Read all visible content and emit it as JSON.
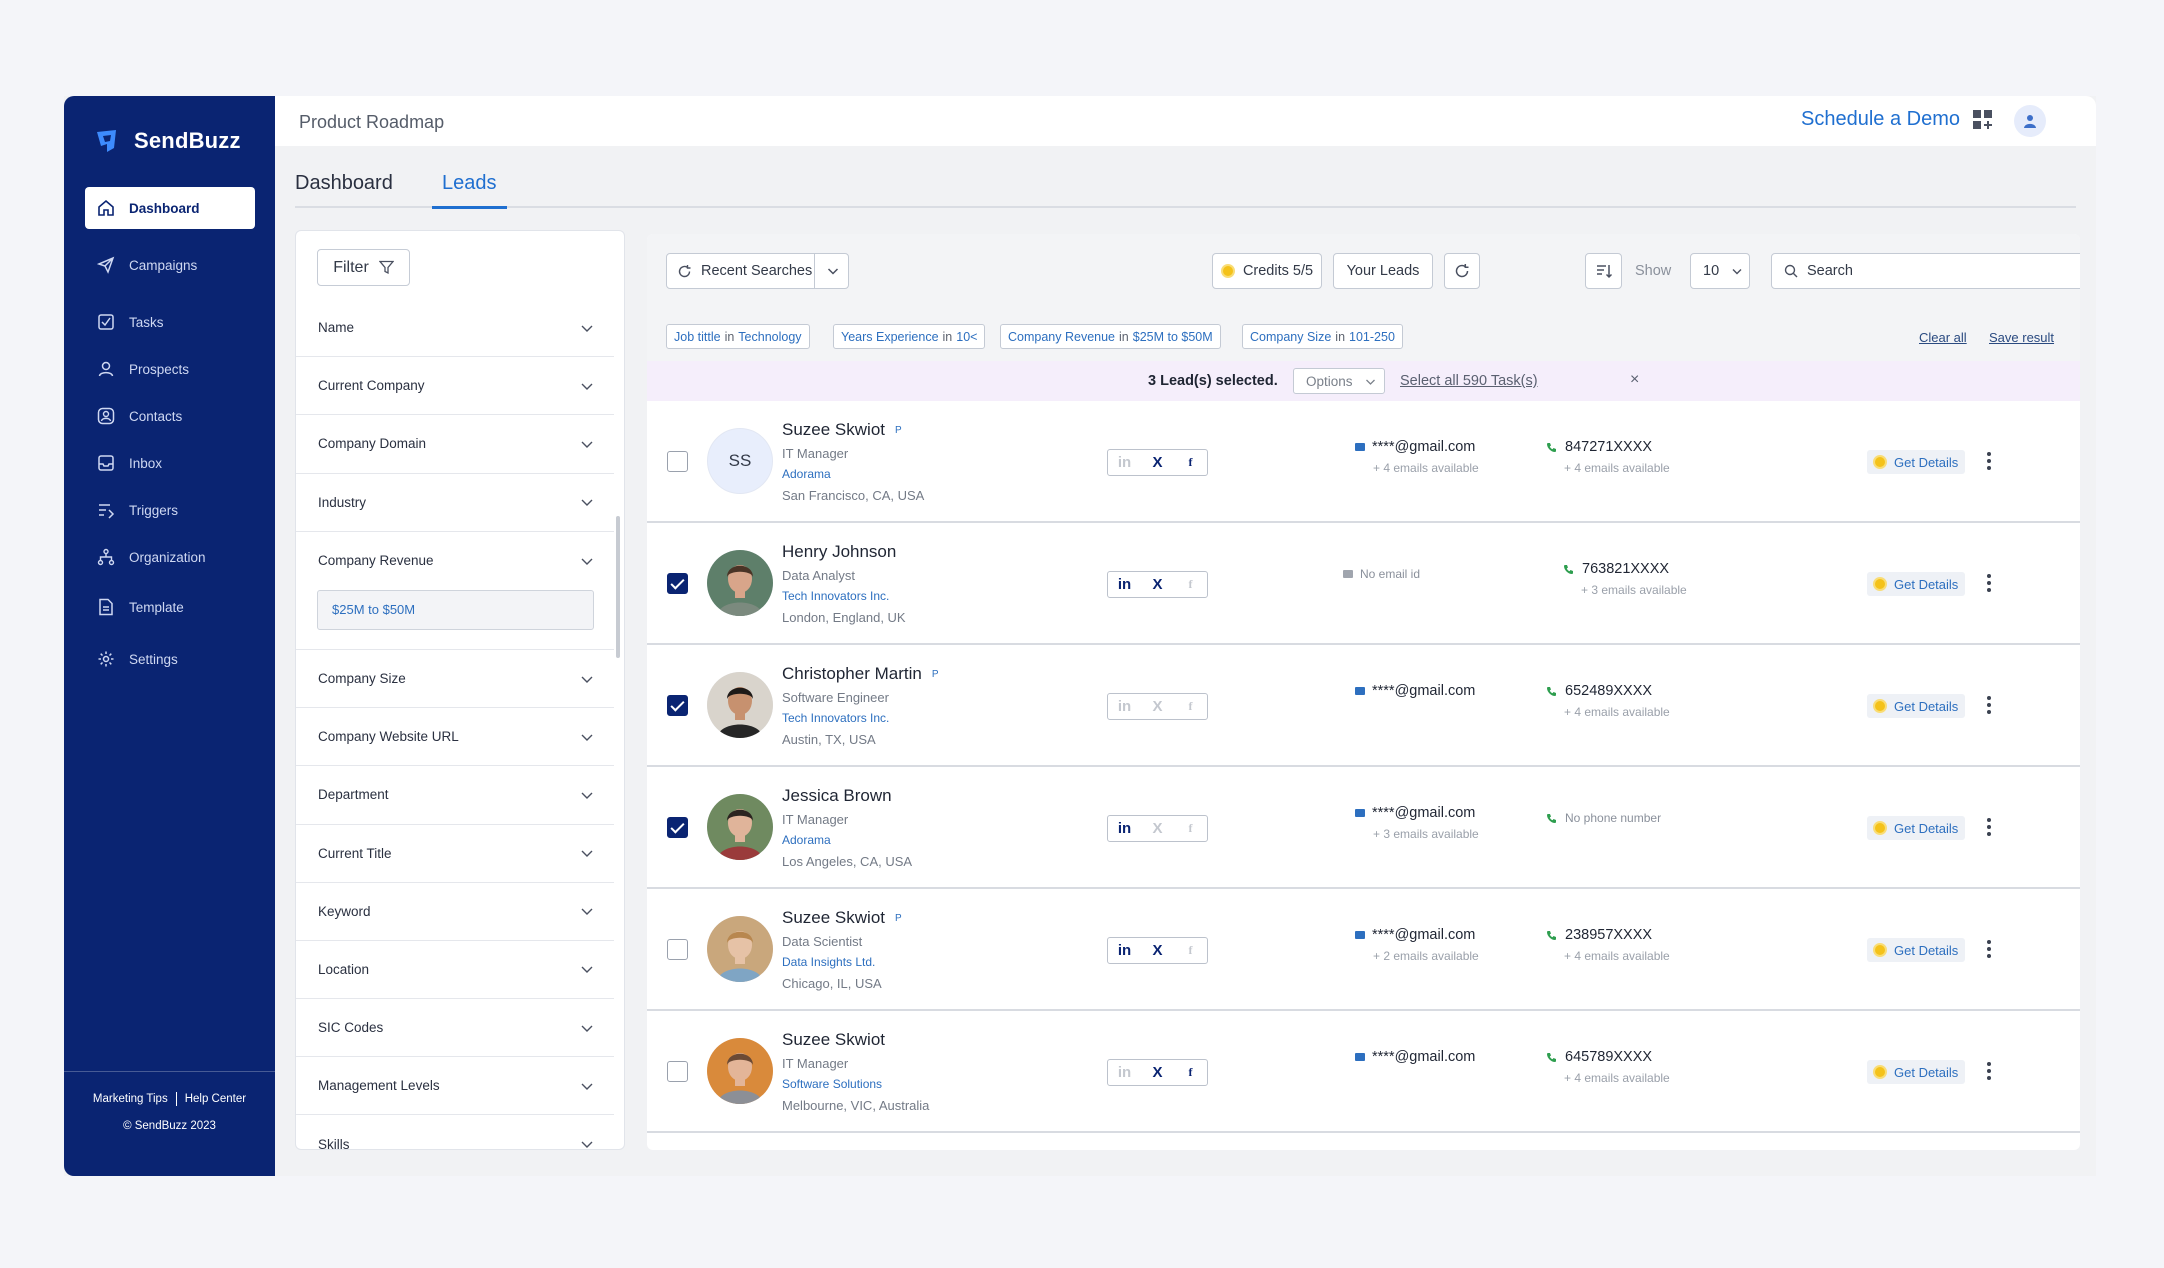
{
  "app": {
    "name": "SendBuzz"
  },
  "sidebar": {
    "items": [
      {
        "label": "Dashboard",
        "icon": "home-icon",
        "active": true
      },
      {
        "label": "Campaigns",
        "icon": "send-icon"
      },
      {
        "label": "Tasks",
        "icon": "task-icon"
      },
      {
        "label": "Prospects",
        "icon": "user-icon"
      },
      {
        "label": "Contacts",
        "icon": "contacts-icon"
      },
      {
        "label": "Inbox",
        "icon": "inbox-icon"
      },
      {
        "label": "Triggers",
        "icon": "triggers-icon"
      },
      {
        "label": "Organization",
        "icon": "organization-icon"
      },
      {
        "label": "Template",
        "icon": "template-icon"
      },
      {
        "label": "Settings",
        "icon": "gear-icon"
      }
    ],
    "footer": {
      "link1": "Marketing Tips",
      "link2": "Help Center",
      "copyright": "© SendBuzz 2023"
    }
  },
  "topbar": {
    "breadcrumb": "Product Roadmap",
    "demo_link": "Schedule a Demo"
  },
  "tabs": [
    {
      "label": "Dashboard"
    },
    {
      "label": "Leads",
      "active": true
    }
  ],
  "filters": {
    "button_label": "Filter",
    "items": [
      "Name",
      "Current Company",
      "Company Domain",
      "Industry",
      "Company Revenue",
      "Company Size",
      "Company Website URL",
      "Department",
      "Current Title",
      "Keyword",
      "Location",
      "SIC Codes",
      "Management Levels",
      "Skills"
    ],
    "revenue_value": "$25M to $50M"
  },
  "toolbar": {
    "recent_searches": "Recent Searches",
    "credits": "Credits 5/5",
    "your_leads": "Your Leads",
    "show_label": "Show",
    "show_value": "10",
    "search_placeholder": "Search"
  },
  "chips": [
    {
      "field": "Job tittle",
      "mid": "in",
      "value": "Technology"
    },
    {
      "field": "Years Experience",
      "mid": "in",
      "value": "10<"
    },
    {
      "field": "Company Revenue",
      "mid": "in",
      "value": "$25M to $50M"
    },
    {
      "field": "Company Size",
      "mid": "in",
      "value": "101-250"
    }
  ],
  "chip_actions": {
    "clear_all": "Clear all",
    "save_result": "Save result"
  },
  "selection": {
    "count_text": "3 Lead(s) selected.",
    "options": "Options",
    "select_all": "Select all 590 Task(s)",
    "close": "×"
  },
  "social_labels": {
    "linkedin": "in",
    "x": "X",
    "facebook": "f"
  },
  "get_details_label": "Get Details",
  "leads": [
    {
      "name": "Suzee Skwiot",
      "badge": "P",
      "initials": "SS",
      "title": "IT Manager",
      "company": "Adorama",
      "location": "San Francisco, CA, USA",
      "checked": false,
      "linkedin": false,
      "x": true,
      "facebook": true,
      "email": "****@gmail.com",
      "email_sub": "+ 4 emails available",
      "phone": "847271XXXX",
      "phone_sub": "+ 4 emails available"
    },
    {
      "name": "Henry Johnson",
      "badge": "",
      "title": "Data Analyst",
      "company": "Tech Innovators Inc.",
      "location": "London, England, UK",
      "checked": true,
      "linkedin": true,
      "x": true,
      "facebook": false,
      "email": "No email id",
      "email_sub": "",
      "phone": "763821XXXX",
      "phone_sub": "+ 3 emails available",
      "skin": "#d8a58a",
      "hair": "#4a3426",
      "bg": "#5e7f6a",
      "shirt": "#7b8a7e"
    },
    {
      "name": "Christopher Martin",
      "badge": "P",
      "title": "Software Engineer",
      "company": "Tech Innovators Inc.",
      "location": "Austin, TX, USA",
      "checked": true,
      "linkedin": false,
      "x": false,
      "facebook": false,
      "email": "****@gmail.com",
      "email_sub": "",
      "phone": "652489XXXX",
      "phone_sub": "+ 4 emails available",
      "skin": "#c7916f",
      "hair": "#1e1a18",
      "bg": "#d9d4cc",
      "shirt": "#262626"
    },
    {
      "name": "Jessica Brown",
      "badge": "",
      "title": "IT Manager",
      "company": "Adorama",
      "location": "Los Angeles, CA, USA",
      "checked": true,
      "linkedin": true,
      "x": false,
      "facebook": false,
      "email": "****@gmail.com",
      "email_sub": "+ 3 emails available",
      "phone": "No phone number",
      "phone_sub": "",
      "skin": "#e0b49a",
      "hair": "#2b2420",
      "bg": "#6f8a60",
      "shirt": "#9a3b3b"
    },
    {
      "name": "Suzee Skwiot",
      "badge": "P",
      "title": "Data Scientist",
      "company": "Data Insights Ltd.",
      "location": "Chicago, IL, USA",
      "checked": false,
      "linkedin": true,
      "x": true,
      "facebook": false,
      "email": "****@gmail.com",
      "email_sub": "+ 2 emails available",
      "phone": "238957XXXX",
      "phone_sub": "+ 4 emails available",
      "skin": "#e6c2a6",
      "hair": "#b8874f",
      "bg": "#c9a77c",
      "shirt": "#7fa5c4"
    },
    {
      "name": "Suzee Skwiot",
      "badge": "",
      "title": "IT Manager",
      "company": "Software Solutions",
      "location": "Melbourne, VIC, Australia",
      "checked": false,
      "linkedin": false,
      "x": true,
      "facebook": true,
      "email": "****@gmail.com",
      "email_sub": "",
      "phone": "645789XXXX",
      "phone_sub": "+ 4 emails available",
      "skin": "#e3b598",
      "hair": "#6b4a35",
      "bg": "#d98a3b",
      "shirt": "#8c8f96"
    }
  ],
  "colors": {
    "sidebar": "#0a2472",
    "accent": "#1f6fd0",
    "link": "#2d6fbf",
    "phone": "#2e9e4f",
    "coin": "#f4c21a",
    "selection_bar": "#f5eefb"
  }
}
